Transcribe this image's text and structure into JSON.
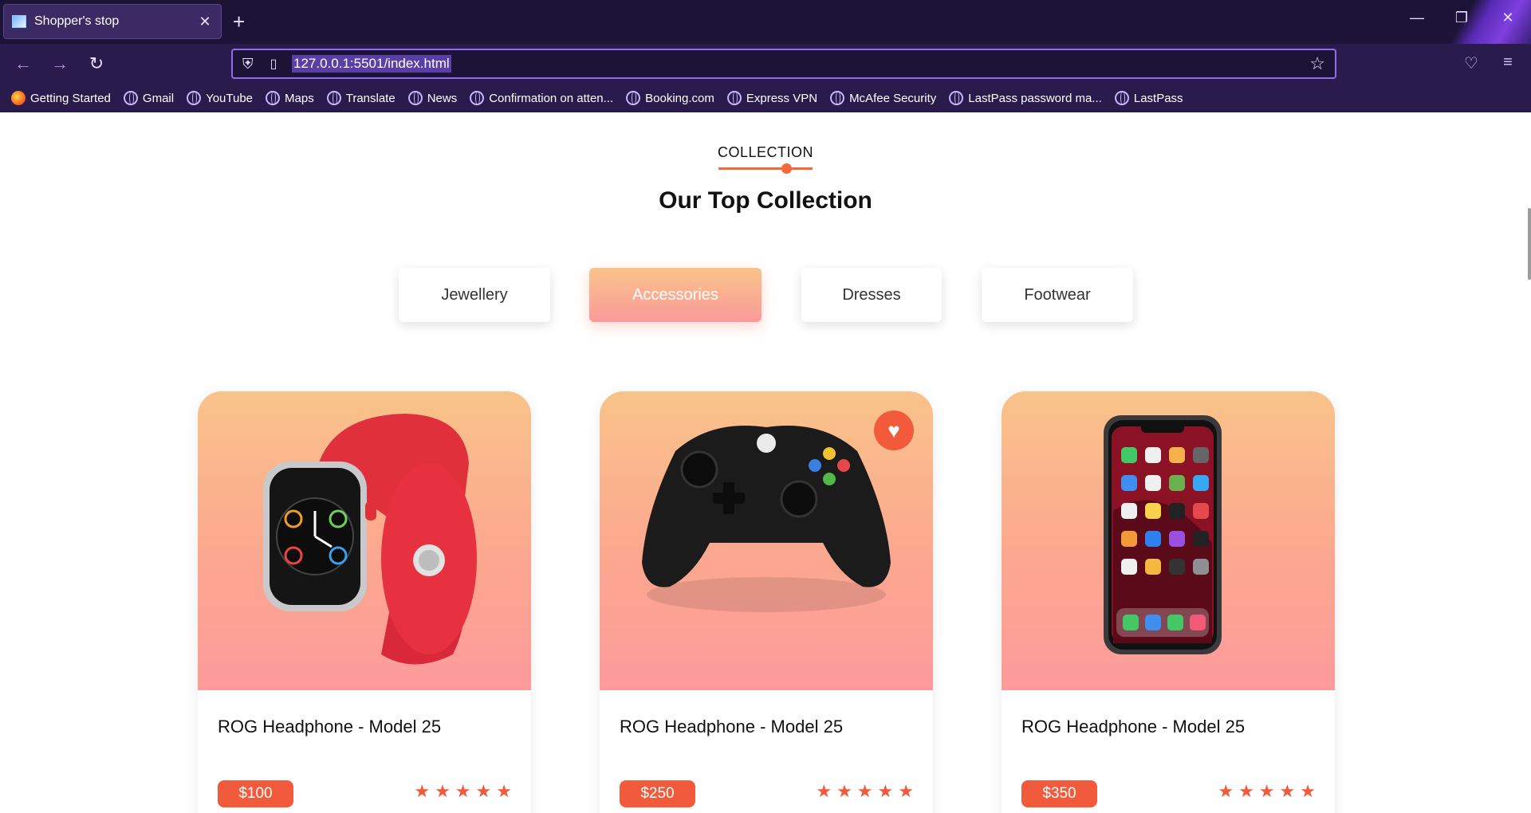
{
  "browser": {
    "tab_title": "Shopper's stop",
    "tab_close": "✕",
    "new_tab": "+",
    "url": "127.0.0.1:5501/index.html",
    "bookmarks": [
      {
        "label": "Getting Started",
        "icon": "firefox-icon"
      },
      {
        "label": "Gmail",
        "icon": "globe-icon"
      },
      {
        "label": "YouTube",
        "icon": "globe-icon"
      },
      {
        "label": "Maps",
        "icon": "globe-icon"
      },
      {
        "label": "Translate",
        "icon": "globe-icon"
      },
      {
        "label": "News",
        "icon": "globe-icon"
      },
      {
        "label": "Confirmation on atten...",
        "icon": "globe-icon"
      },
      {
        "label": "Booking.com",
        "icon": "globe-icon"
      },
      {
        "label": "Express VPN",
        "icon": "globe-icon"
      },
      {
        "label": "McAfee Security",
        "icon": "globe-icon"
      },
      {
        "label": "LastPass password ma...",
        "icon": "globe-icon"
      },
      {
        "label": "LastPass",
        "icon": "globe-icon"
      }
    ]
  },
  "collection": {
    "label": "COLLECTION",
    "title": "Our Top Collection",
    "categories": [
      {
        "label": "Jewellery",
        "active": false
      },
      {
        "label": "Accessories",
        "active": true
      },
      {
        "label": "Dresses",
        "active": false
      },
      {
        "label": "Footwear",
        "active": false
      }
    ]
  },
  "products": [
    {
      "name": "ROG Headphone - Model 25",
      "price": "$100",
      "rating": 5,
      "image": "smartwatch-image",
      "favorite": false
    },
    {
      "name": "ROG Headphone - Model 25",
      "price": "$250",
      "rating": 5,
      "image": "game-controller-image",
      "favorite": true
    },
    {
      "name": "ROG Headphone - Model 25",
      "price": "$350",
      "rating": 5,
      "image": "smartphone-image",
      "favorite": false
    }
  ],
  "colors": {
    "accent": "#f25a3c",
    "gradient_top": "#f9c38a",
    "gradient_bottom": "#fd9b9b",
    "browser_bg": "#1c1336"
  }
}
